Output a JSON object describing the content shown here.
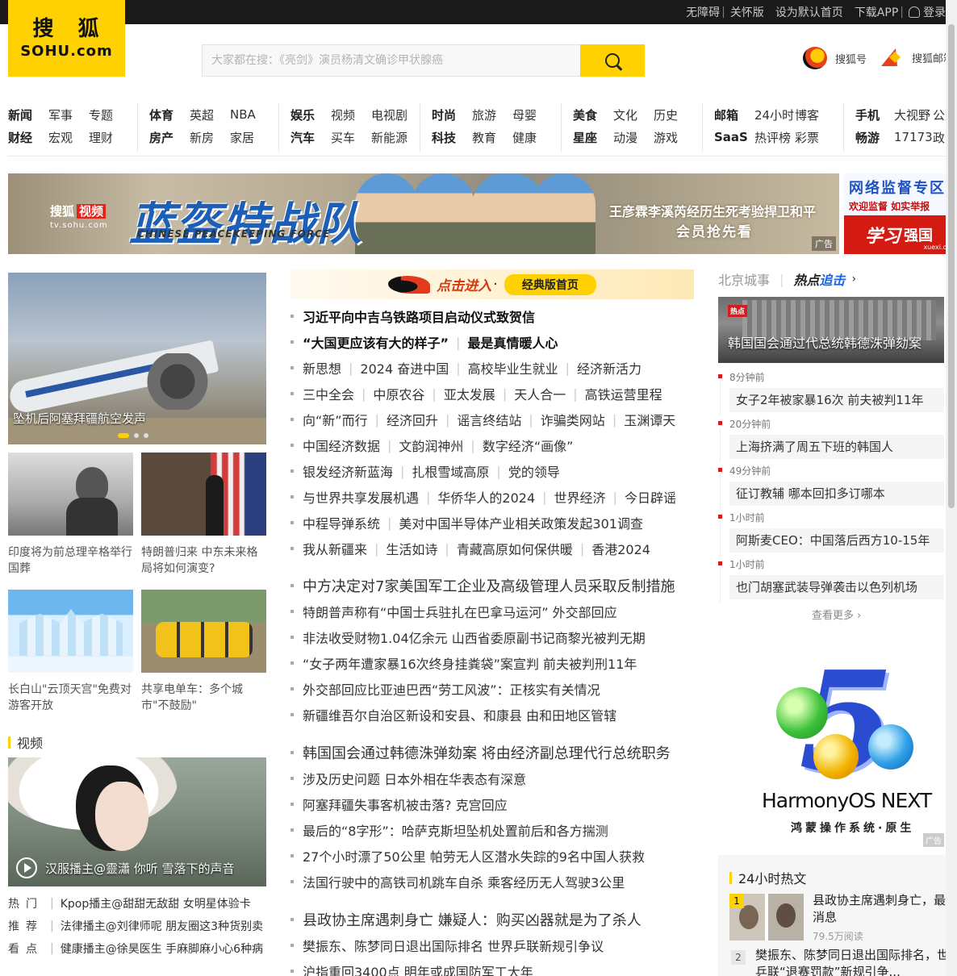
{
  "topbar": {
    "accessibility": "无障碍",
    "care_mode": "关怀版",
    "set_homepage": "设为默认首页",
    "download_app": "下载APP",
    "login": "登录"
  },
  "logo": {
    "cn": "搜狐",
    "en": "SOHU.com"
  },
  "search": {
    "placeholder": "大家都在搜：《亮剑》演员杨清文确诊甲状腺癌"
  },
  "header_links": {
    "sohuhao": "搜狐号",
    "mail": "搜狐邮箱"
  },
  "nav": [
    {
      "row1": [
        "新闻",
        "军事",
        "专题"
      ],
      "row2": [
        "财经",
        "宏观",
        "理财"
      ]
    },
    {
      "row1": [
        "体育",
        "英超",
        "NBA"
      ],
      "row2": [
        "房产",
        "新房",
        "家居"
      ]
    },
    {
      "row1": [
        "娱乐",
        "视频",
        "电视剧"
      ],
      "row2": [
        "汽车",
        "买车",
        "新能源"
      ]
    },
    {
      "row1": [
        "时尚",
        "旅游",
        "母婴"
      ],
      "row2": [
        "科技",
        "教育",
        "健康"
      ]
    },
    {
      "row1": [
        "美食",
        "文化",
        "历史"
      ],
      "row2": [
        "星座",
        "动漫",
        "游戏"
      ]
    },
    {
      "row1": [
        "邮箱",
        "24小时",
        "博客"
      ],
      "row2": [
        "SaaS",
        "热评榜",
        "彩票"
      ]
    },
    {
      "row1": [
        "手机",
        "大视野",
        "公益"
      ],
      "row2": [
        "畅游",
        "17173",
        "政务"
      ]
    }
  ],
  "banner": {
    "brand": "搜狐",
    "brand_box": "视频",
    "url": "tv.sohu.com",
    "title": "蓝盔特战队",
    "title_en": "CHINESE PEACEKEEPING FORCE",
    "cast": "王彦霖李溪芮经历生死考验捍卫和平",
    "cta": "会员抢先看",
    "ad": "广告"
  },
  "side_ad": {
    "line1": "网络监督专区",
    "line2": "欢迎监督 如实举报",
    "brand1": "学习",
    "brand2": "强国",
    "domain": "xuexi.cn"
  },
  "feature": {
    "caption": "坠机后阿塞拜疆航空发声"
  },
  "thumbs": [
    {
      "caption": "印度将为前总理辛格举行国葬"
    },
    {
      "caption": "特朗普归来 中东未来格局将如何演变?"
    },
    {
      "caption": "长白山\"云顶天宫\"免费对游客开放"
    },
    {
      "caption": "共享电单车：多个城市\"不鼓励\""
    }
  ],
  "video_section": {
    "title": "视频",
    "caption": "汉服播主@靈瀟 你听 雪落下的声音",
    "list": [
      {
        "tag": "热门",
        "text": "Kpop播主@甜甜无敌甜 女明星体验卡"
      },
      {
        "tag": "推荐",
        "text": "法律播主@刘律师呢 朋友圈这3种货别卖"
      },
      {
        "tag": "看点",
        "text": "健康播主@徐昊医生 手麻脚麻小心6种病"
      }
    ]
  },
  "click_banner": {
    "enter": "点击进入",
    "button": "经典版首页"
  },
  "news_block1": [
    {
      "items": [
        "习近平向中吉乌铁路项目启动仪式致贺信"
      ],
      "bold": true
    },
    {
      "items": [
        "“大国更应该有大的样子”",
        "最是真情暖人心"
      ],
      "bold": true
    },
    {
      "items": [
        "新思想",
        "2024 奋进中国",
        "高校毕业生就业",
        "经济新活力"
      ]
    },
    {
      "items": [
        "三中全会",
        "中原农谷",
        "亚太发展",
        "天人合一",
        "高铁运营里程"
      ]
    },
    {
      "items": [
        "向“新”而行",
        "经济回升",
        "谣言终结站",
        "诈骗类网站",
        "玉渊谭天"
      ]
    },
    {
      "items": [
        "中国经济数据",
        "文韵润神州",
        "数字经济“画像”"
      ]
    },
    {
      "items": [
        "银发经济新蓝海",
        "扎根雪域高原",
        "党的领导"
      ]
    },
    {
      "items": [
        "与世界共享发展机遇",
        "华侨华人的2024",
        "世界经济",
        "今日辟谣"
      ]
    },
    {
      "items": [
        "中程导弹系统",
        "美对中国半导体产业相关政策发起301调查"
      ]
    },
    {
      "items": [
        "我从新疆来",
        "生活如诗",
        "青藏高原如何保供暖",
        "香港2024"
      ]
    }
  ],
  "news_block2": [
    {
      "text": "中方决定对7家美国军工企业及高级管理人员采取反制措施",
      "big": true
    },
    {
      "text": "特朗普声称有“中国士兵驻扎在巴拿马运河” 外交部回应"
    },
    {
      "text": "非法收受财物1.04亿余元 山西省委原副书记商黎光被判无期"
    },
    {
      "text": "“女子两年遭家暴16次终身挂粪袋”案宣判 前夫被判刑11年"
    },
    {
      "text": "外交部回应比亚迪巴西“劳工风波”：正核实有关情况"
    },
    {
      "text": "新疆维吾尔自治区新设和安县、和康县 由和田地区管辖"
    }
  ],
  "news_block3": [
    {
      "text": "韩国国会通过韩德洙弹劾案 将由经济副总理代行总统职务",
      "big": true
    },
    {
      "text": "涉及历史问题 日本外相在华表态有深意"
    },
    {
      "text": "阿塞拜疆失事客机被击落? 克宫回应"
    },
    {
      "text": "最后的“8字形”：哈萨克斯坦坠机处置前后和各方揣测"
    },
    {
      "text": "27个小时漂了50公里 帕劳无人区潜水失踪的9名中国人获救"
    },
    {
      "text": "法国行驶中的高铁司机跳车自杀 乘客经历无人驾驶3公里"
    }
  ],
  "news_block4": [
    {
      "text": "县政协主席遇刺身亡 嫌疑人：购买凶器就是为了杀人",
      "big": true
    },
    {
      "text": "樊振东、陈梦同日退出国际排名 世界乒联新规引争议"
    },
    {
      "text": "沪指重回3400点 明年或成国防军工大年"
    }
  ],
  "right": {
    "tab_city": "北京城事",
    "tab_hot": "热点",
    "tab_hot_chase": "追击",
    "hot_badge": "热点",
    "hot_caption": "韩国国会通过代总统韩德洙弹劾案",
    "timeline": [
      {
        "time": "8分钟前",
        "text": "女子2年被家暴16次 前夫被判11年"
      },
      {
        "time": "20分钟前",
        "text": "上海挤满了周五下班的韩国人"
      },
      {
        "time": "49分钟前",
        "text": "征订教辅 哪本回扣多订哪本"
      },
      {
        "time": "1小时前",
        "text": "阿斯麦CEO：中国落后西方10-15年"
      },
      {
        "time": "1小时前",
        "text": "也门胡塞武装导弹袭击以色列机场"
      }
    ],
    "more": "查看更多",
    "harmony_name": "HarmonyOS NEXT",
    "harmony_sub": "鸿蒙操作系统·原生",
    "harmony_digit": "5",
    "harmony_ad": "广告",
    "hot24_title": "24小时热文",
    "hot24_items": [
      {
        "rank": "1",
        "line1": "县政协主席遇刺身亡，最新",
        "line2": "消息",
        "reads": "79.5万阅读"
      },
      {
        "rank": "2",
        "line1": "樊振东、陈梦同日退出国际排名，世界",
        "line2": "乒联“退赛罚款”新规引争..."
      }
    ]
  }
}
